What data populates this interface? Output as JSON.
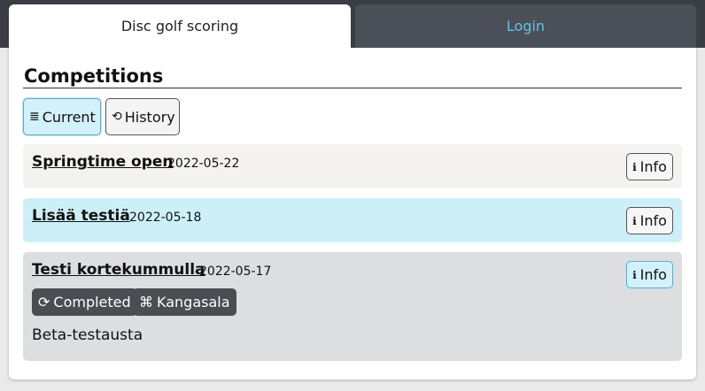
{
  "tabs": {
    "home": "Disc golf scoring",
    "login": "Login"
  },
  "page": {
    "title": "Competitions"
  },
  "filters": {
    "current": {
      "icon": "≣",
      "icon_name": "list-icon",
      "label": "Current"
    },
    "history": {
      "icon": "⟲",
      "icon_name": "history-icon",
      "label": "History"
    }
  },
  "competitions": [
    {
      "name": "Springtime open",
      "date": "2022-05-22",
      "info_icon": "ℹ",
      "info_label": "Info"
    },
    {
      "name": "Lisää testiä",
      "date": "2022-05-18",
      "info_icon": "ℹ",
      "info_label": "Info"
    },
    {
      "name": "Testi kortekummulla",
      "date": "2022-05-17",
      "info_icon": "ℹ",
      "info_label": "Info",
      "status_icon": "⟳",
      "status": "Completed",
      "location_icon": "⌘",
      "location": "Kangasala",
      "description": "Beta-testausta"
    }
  ],
  "colors": {
    "topbar": "#3a3d44",
    "login_tab_text": "#5fc3e6",
    "active_bg": "#d3f1fa",
    "highlight_row": "#cdf0f8",
    "expanded_row": "#dddee0",
    "badge_bg": "#4a4d52"
  }
}
